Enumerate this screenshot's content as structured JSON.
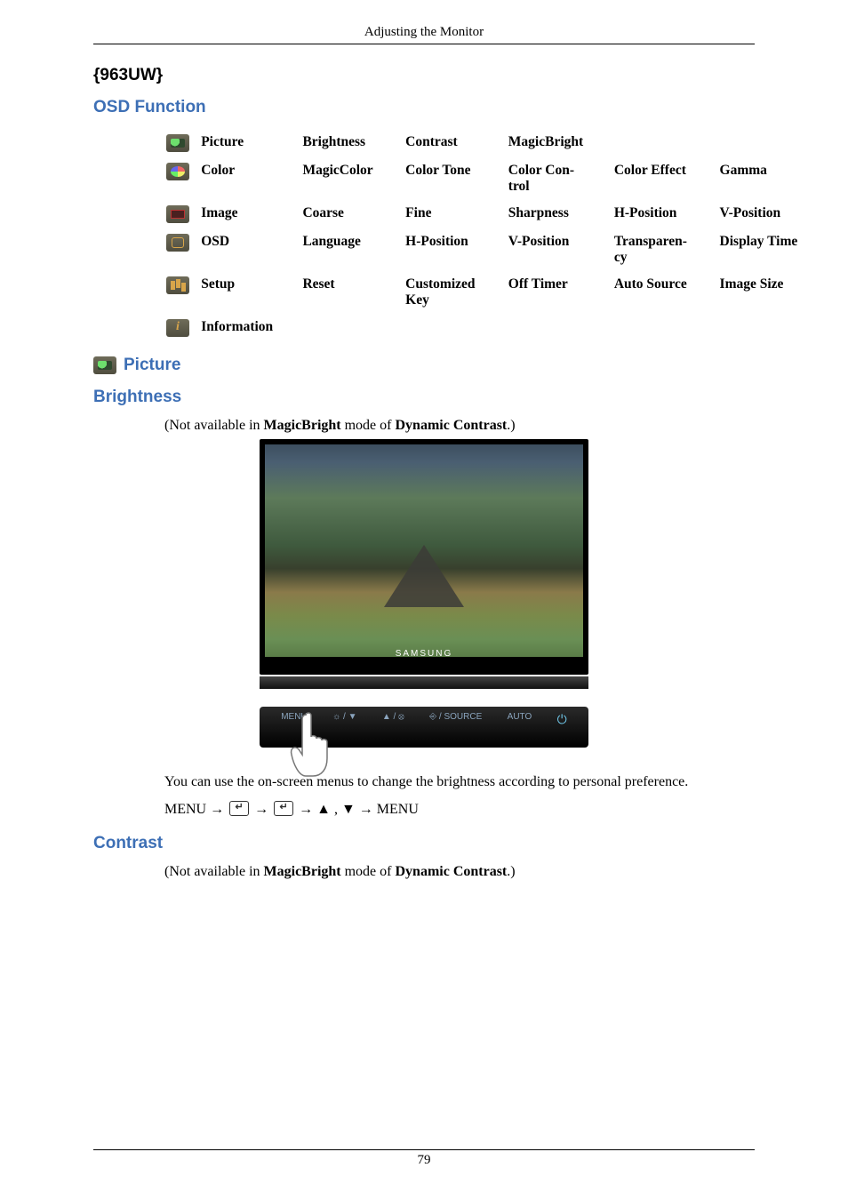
{
  "running_head": "Adjusting the Monitor",
  "model": "{963UW}",
  "osd_heading": "OSD Function",
  "picture_heading": "Picture",
  "brightness_heading": "Brightness",
  "contrast_heading": "Contrast",
  "brightness_note": {
    "prefix": "(Not available in ",
    "b1": "MagicBright",
    "mid": "  mode of ",
    "b2": "Dynamic Contrast",
    "suffix": ".)"
  },
  "contrast_note": {
    "prefix": "(Not available in ",
    "b1": "MagicBright",
    "mid": " mode of ",
    "b2": "Dynamic Contrast",
    "suffix": ".)"
  },
  "monitor_brand": "SAMSUNG",
  "bezel_status": "",
  "buttons": {
    "menu": "MENU",
    "bright": "☼ / ▼",
    "vol": "▲ / ⦻",
    "source": "⎆ / SOURCE",
    "auto": "AUTO",
    "power": "⏻"
  },
  "body_text": "You can use the on-screen menus to change the brightness according to personal preference.",
  "menu_path": {
    "m1": "MENU → ",
    "m2": " → ",
    "m3": " → ",
    "arrows": "▲ , ▼",
    "m4": " → MENU"
  },
  "osd_rows": [
    {
      "icon": "picture",
      "label": "Picture",
      "c1": "Brightness",
      "c2": "Contrast",
      "c3": "MagicBright",
      "c4": "",
      "c5": ""
    },
    {
      "icon": "color",
      "label": "Color",
      "c1": "MagicColor",
      "c2": "Color Tone",
      "c3": "Color Con-\ntrol",
      "c4": "Color Effect",
      "c5": "Gamma"
    },
    {
      "icon": "image",
      "label": "Image",
      "c1": "Coarse",
      "c2": "Fine",
      "c3": "Sharpness",
      "c4": "H-Position",
      "c5": "V-Position"
    },
    {
      "icon": "osd",
      "label": "OSD",
      "c1": "Language",
      "c2": "H-Position",
      "c3": "V-Position",
      "c4": "Transparen-\ncy",
      "c5": "Display Time"
    },
    {
      "icon": "setup",
      "label": "Setup",
      "c1": "Reset",
      "c2": "Customized\nKey",
      "c3": "Off Timer",
      "c4": "Auto Source",
      "c5": "Image Size"
    },
    {
      "icon": "info",
      "label": "Information",
      "c1": "",
      "c2": "",
      "c3": "",
      "c4": "",
      "c5": ""
    }
  ],
  "page_number": "79"
}
